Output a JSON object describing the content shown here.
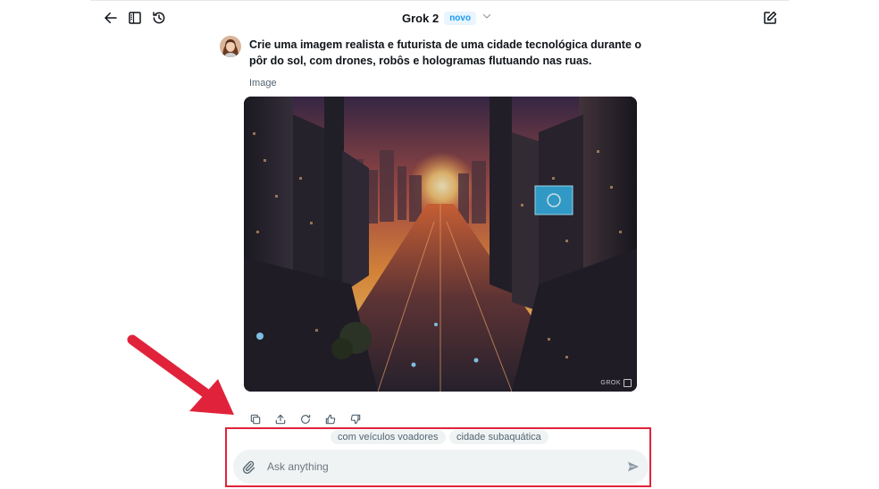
{
  "header": {
    "model_name": "Grok 2",
    "badge": "novo",
    "icons": [
      "back-arrow-icon",
      "sidebar-panel-icon",
      "history-icon",
      "chevron-down-icon",
      "new-chat-icon"
    ]
  },
  "conversation": {
    "prompt": "Crie uma imagem realista e futurista de uma cidade tecnológica durante o pôr do sol, com drones, robôs e hologramas flutuando nas ruas.",
    "response_label": "Image",
    "image_watermark": "GROK"
  },
  "response_actions": [
    "copy-icon",
    "share-icon",
    "regenerate-icon",
    "thumbs-up-icon",
    "thumbs-down-icon"
  ],
  "suggestions": [
    "com veículos voadores",
    "cidade subaquática"
  ],
  "composer": {
    "placeholder": "Ask anything",
    "value": ""
  },
  "colors": {
    "accent": "#1d9bf0",
    "annotation": "#e0233b",
    "input_bg": "#eff3f4"
  }
}
